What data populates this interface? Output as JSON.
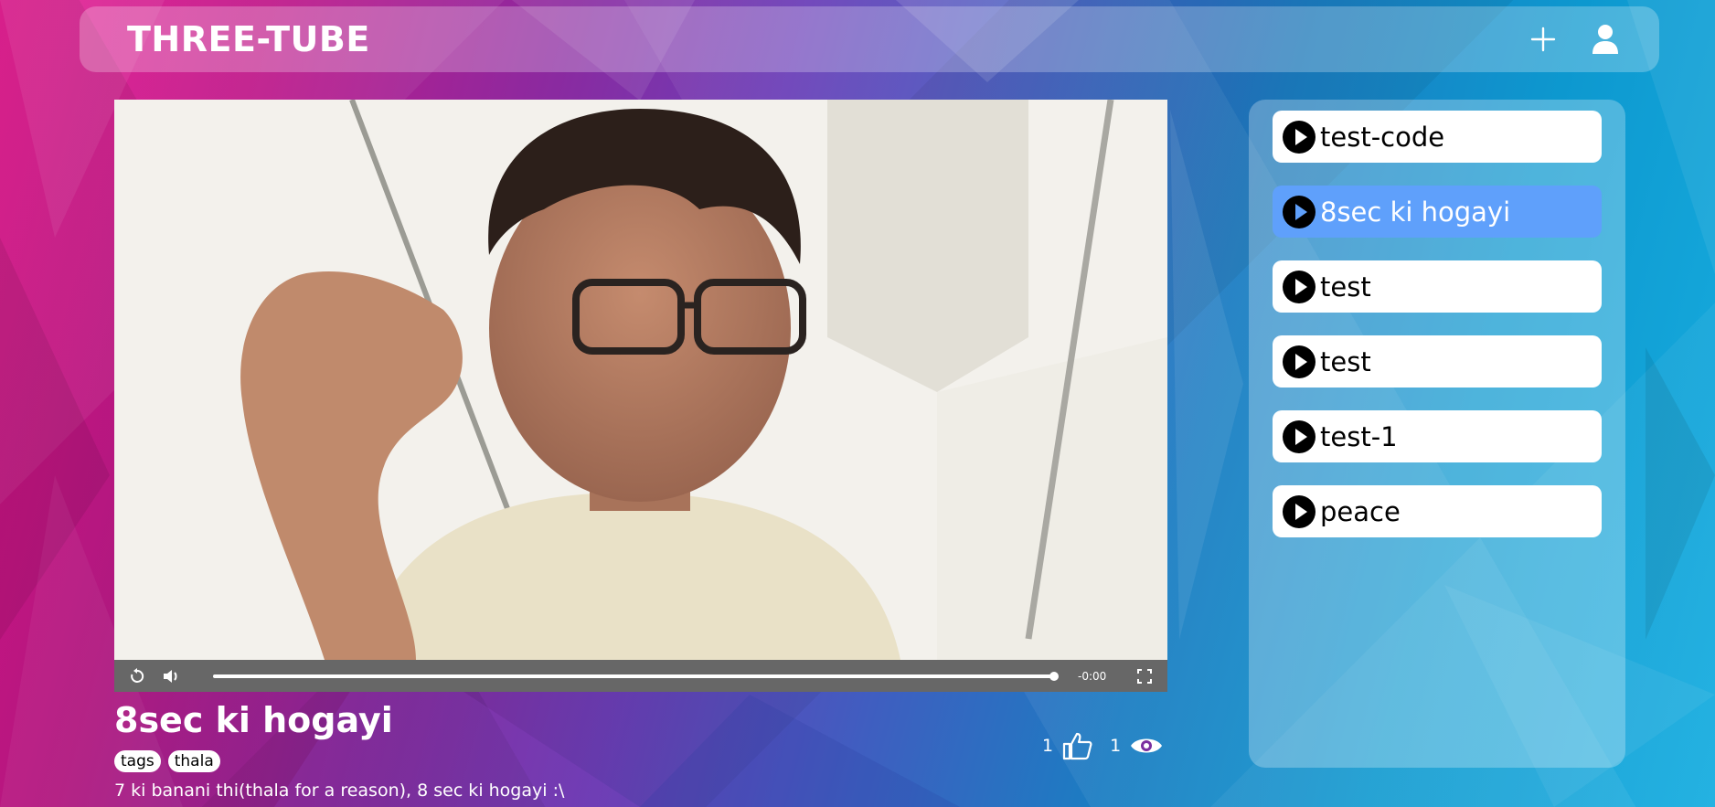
{
  "app": {
    "title": "THREE-TUBE"
  },
  "header": {
    "add_icon": "plus-icon",
    "profile_icon": "user-icon"
  },
  "player": {
    "time_remaining": "-0:00",
    "progress": 1.0,
    "icons": [
      "replay-icon",
      "volume-icon",
      "fullscreen-icon"
    ]
  },
  "video": {
    "title": "8sec ki hogayi",
    "tags": [
      "tags",
      "thala"
    ],
    "description": "7 ki banani thi(thala for a reason), 8 sec ki hogayi :\\",
    "likes": "1",
    "views": "1"
  },
  "playlist": {
    "items": [
      {
        "label": "test-code",
        "active": false
      },
      {
        "label": "8sec ki hogayi",
        "active": true
      },
      {
        "label": "test",
        "active": false
      },
      {
        "label": "test",
        "active": false
      },
      {
        "label": "test-1",
        "active": false
      },
      {
        "label": "peace",
        "active": false
      }
    ]
  },
  "colors": {
    "active_item": "#5fa0fb",
    "bg_left": "#e8128f",
    "bg_right": "#18aee0"
  }
}
